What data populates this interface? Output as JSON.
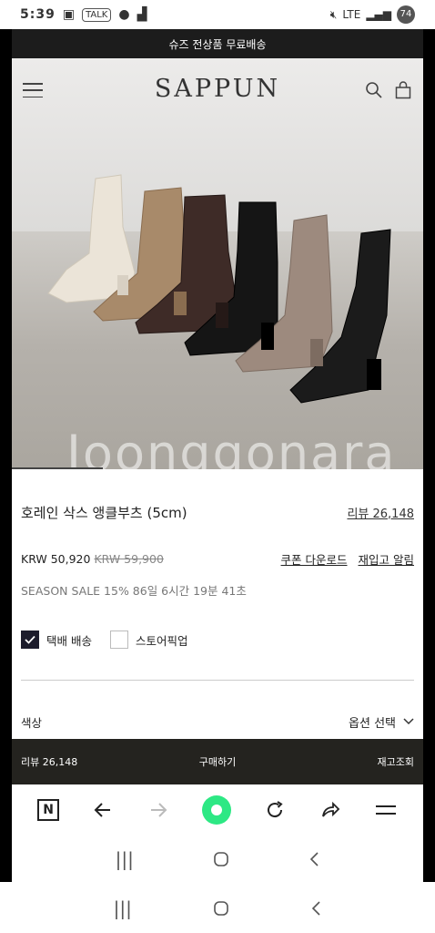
{
  "status": {
    "time": "5:39",
    "left_icons": [
      "gallery-icon",
      "talk-icon",
      "chat-icon",
      "signal-small-icon"
    ],
    "right_icons": [
      "mute-icon",
      "lte-icon",
      "signal-icon"
    ],
    "battery": "74"
  },
  "promo": {
    "text": "슈즈 전상품 무료배송"
  },
  "header": {
    "logo": "SAPPUN"
  },
  "hero": {
    "watermark": "Joonggonara"
  },
  "product": {
    "title": "호레인 삭스 앵클부츠 (5cm)",
    "review_link": "리뷰 26,148",
    "price": "KRW 50,920",
    "old_price": "KRW 59,900",
    "coupon_link": "쿠폰 다운로드",
    "restock_link": "재입고 알림",
    "sale_text": "SEASON SALE 15% 86일 6시간 19분 41초",
    "delivery_label": "택배 배송",
    "pickup_label": "스토어픽업",
    "color_label": "색상",
    "option_select": "옵션 선택"
  },
  "bottom_bar": {
    "review": "리뷰 26,148",
    "buy": "구매하기",
    "stock": "재고조회"
  },
  "browser": {
    "n_label": "N"
  },
  "colors": {
    "accent_green": "#2de884",
    "dark_bar": "#24231f"
  }
}
